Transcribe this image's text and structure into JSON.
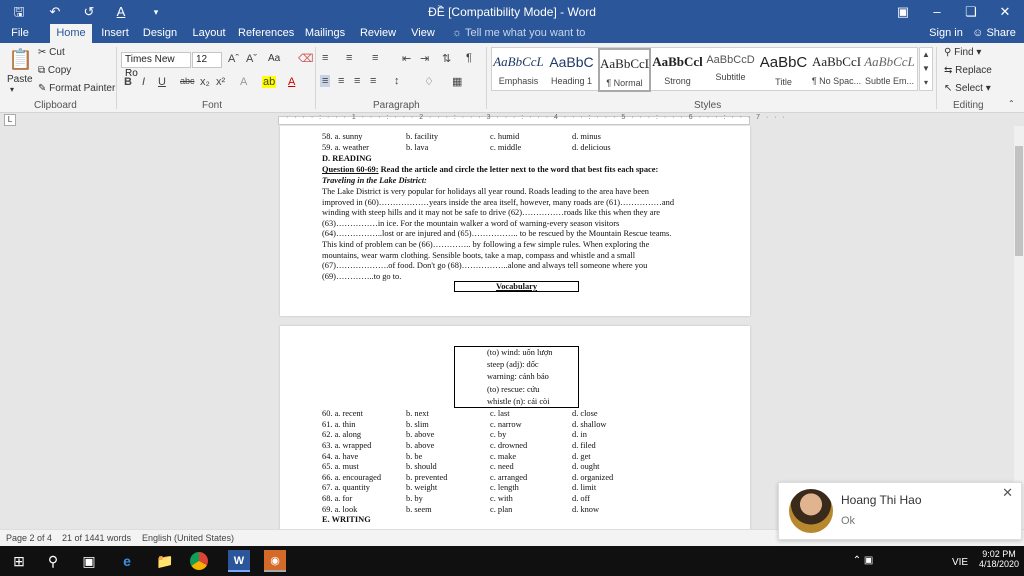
{
  "window": {
    "title": "ĐỀ [Compatibility Mode] - Word",
    "qat": [
      "save-icon",
      "undo-icon",
      "redo-icon",
      "font-color-icon",
      "customize-icon"
    ],
    "controls": [
      "ribbon-display-icon",
      "minimize-icon",
      "restore-icon",
      "close-icon"
    ]
  },
  "tabs": [
    "File",
    "Home",
    "Insert",
    "Design",
    "Layout",
    "References",
    "Mailings",
    "Review",
    "View"
  ],
  "tell_me": "Tell me what you want to do...",
  "sign_in": "Sign in",
  "share": "Share",
  "clipboard": {
    "paste": "Paste",
    "cut": "Cut",
    "copy": "Copy",
    "format_painter": "Format Painter",
    "label": "Clipboard"
  },
  "font": {
    "name": "Times New Ro",
    "size": "12",
    "label": "Font",
    "aa": "Aa"
  },
  "paragraph": {
    "label": "Paragraph"
  },
  "styles": {
    "label": "Styles",
    "items": [
      {
        "sample": "AaBbCcL",
        "name": "Emphasis"
      },
      {
        "sample": "AaBbC",
        "name": "Heading 1"
      },
      {
        "sample": "AaBbCcL",
        "name": "¶ Normal"
      },
      {
        "sample": "AaBbCcl",
        "name": "Strong"
      },
      {
        "sample": "AaBbCcD",
        "name": "Subtitle"
      },
      {
        "sample": "AaBbC",
        "name": "Title"
      },
      {
        "sample": "AaBbCcI",
        "name": "¶ No Spac..."
      },
      {
        "sample": "AaBbCcL",
        "name": "Subtle Em..."
      }
    ]
  },
  "editing": {
    "find": "Find",
    "replace": "Replace",
    "select": "Select",
    "label": "Editing"
  },
  "page1": {
    "rows_top": [
      [
        "58. a. sunny",
        "b. facility",
        "c. humid",
        "d. minus"
      ],
      [
        "59. a. weather",
        "b. lava",
        "c. middle",
        "d. delicious"
      ]
    ],
    "section": "D. READING",
    "question_head": "Question 60-69:",
    "question_text": "Read the article and circle the letter next to the word that best fits each space:",
    "article_title": "Traveling in the Lake District:",
    "lines": [
      "The Lake District is very popular for holidays all year round. Roads leading to the area have been",
      "improved in (60)………………years inside the area itself, however, many roads are (61)……………and",
      "winding with steep hills and it may not be safe to drive (62)……………roads like this when they are",
      "(63)……………in ice. For the mountain walker a word of warning-every season visitors",
      "(64)……………..lost or are injured and (65)…………….. to be rescued by the Mountain Rescue teams.",
      "This kind of problem can be (66)………….. by following a few simple rules. When exploring the",
      "mountains, wear warm clothing. Sensible boots, take a map, compass and whistle and a small",
      "(67)……………….of food. Don't go (68)……………..alone and always tell someone where you",
      "(69)…………..to go to."
    ],
    "vocab_head": "Vocabulary"
  },
  "page2": {
    "vocab": [
      "(to) wind: uốn lượn",
      "steep (adj): dốc",
      "warning: cảnh báo",
      "(to) rescue: cứu",
      "whistle (n): cái còi"
    ],
    "rows": [
      [
        "60. a. recent",
        "b. next",
        "c. last",
        "d. close"
      ],
      [
        "61. a. thin",
        "b. slim",
        "c. narrow",
        "d. shallow"
      ],
      [
        "62. a. along",
        "b. above",
        "c. by",
        "d. in"
      ],
      [
        "63. a. wrapped",
        "b. above",
        "c. drowned",
        "d. filed"
      ],
      [
        "64. a. have",
        "b. be",
        "c. make",
        "d. get"
      ],
      [
        "65. a. must",
        "b. should",
        "c. need",
        "d. ought"
      ],
      [
        "66. a. encouraged",
        "b. prevented",
        "c. arranged",
        "d. organized"
      ],
      [
        "67. a. quantity",
        "b. weight",
        "c. length",
        "d. limit"
      ],
      [
        "68. a. for",
        "b. by",
        "c. with",
        "d. off"
      ],
      [
        "69. a. look",
        "b. seem",
        "c. plan",
        "d. know"
      ]
    ],
    "section": "E. WRITING"
  },
  "status": {
    "page": "Page 2 of 4",
    "words": "21 of 1441 words",
    "lang": "English (United States)"
  },
  "notification": {
    "name": "Hoang Thi Hao",
    "message": "Ok"
  },
  "taskbar": {
    "lang": "VIE",
    "time": "9:02 PM",
    "date": "4/18/2020"
  }
}
